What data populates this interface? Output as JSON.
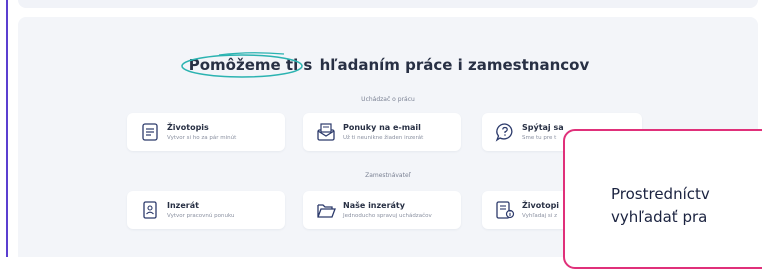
{
  "headline": {
    "highlight": "Pomôžeme ti s",
    "rest": " hľadaním práce i zamestnancov"
  },
  "sections": {
    "job_seeker": "Uchádzač o prácu",
    "employer": "Zamestnávateľ"
  },
  "cards": {
    "zivotopis": {
      "title": "Životopis",
      "desc": "Vytvor si ho za pár minút",
      "icon": "document-icon"
    },
    "ponuky": {
      "title": "Ponuky na e-mail",
      "desc": "Už ti neunikne žiaden inzerát",
      "icon": "mail-icon"
    },
    "spytaj": {
      "title": "Spýtaj sa",
      "desc": "Sme tu pre t",
      "icon": "question-bubble-icon"
    },
    "inzerat": {
      "title": "Inzerát",
      "desc": "Vytvor pracovnú ponuku",
      "icon": "badge-icon"
    },
    "nase": {
      "title": "Naše inzeráty",
      "desc": "Jednoducho spravuj uchádzačov",
      "icon": "folder-icon"
    },
    "zivotopisy": {
      "title": "Životopi",
      "desc": "Vyhľadaj si z",
      "icon": "document-search-icon"
    }
  },
  "modal": {
    "line1": "Prostredníctv",
    "line2": "vyhľadať pra"
  },
  "colors": {
    "accent_ring": "#2bb3b1",
    "modal_border": "#e0307a",
    "icon": "#2c3a6b"
  }
}
